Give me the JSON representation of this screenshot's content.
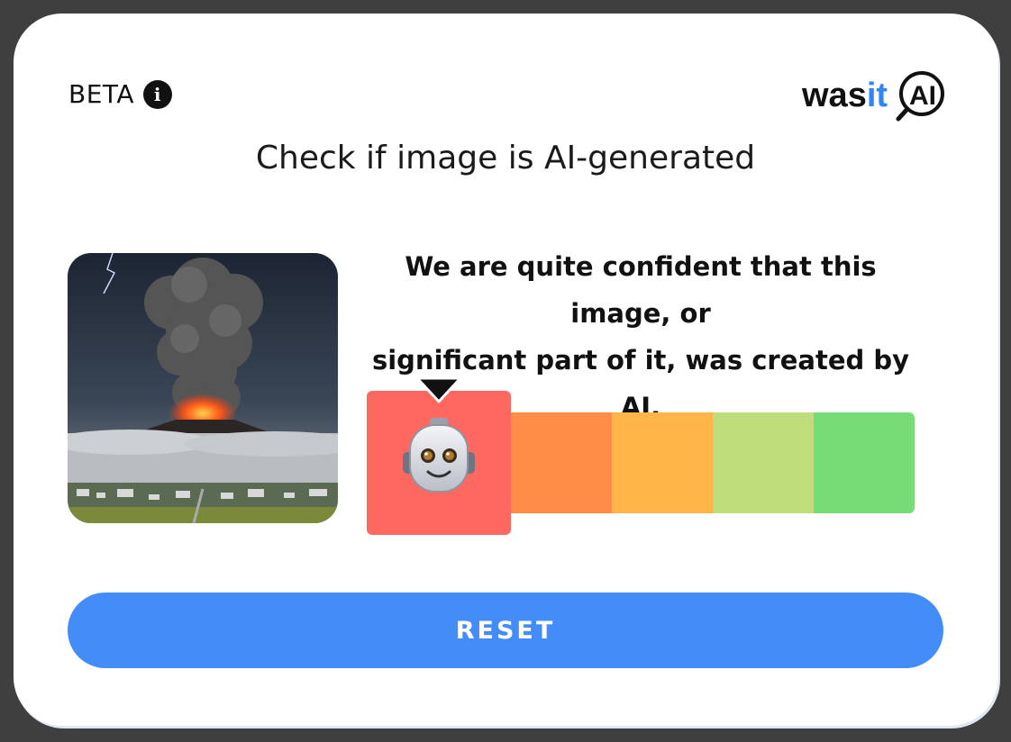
{
  "header": {
    "beta_label": "BETA",
    "info_icon": "info-icon",
    "logo": {
      "part1": "was",
      "part2": "it",
      "part3": "AI",
      "icon": "magnifier-icon"
    }
  },
  "title": "Check if image is AI-generated",
  "result": {
    "image_alt": "volcano eruption photo",
    "verdict_line1": "We are quite confident that this image, or",
    "verdict_line2": "significant part of it, was created by AI.",
    "scale": {
      "levels": 5,
      "selected_level": 1,
      "selected_icon": "robot-face-icon",
      "colors": [
        "#ff6860",
        "#ff8d48",
        "#ffb548",
        "#bedd7b",
        "#76dd76"
      ]
    }
  },
  "actions": {
    "reset_label": "RESET"
  },
  "colors": {
    "accent": "#448cf8",
    "logo_accent": "#2f86f6"
  }
}
